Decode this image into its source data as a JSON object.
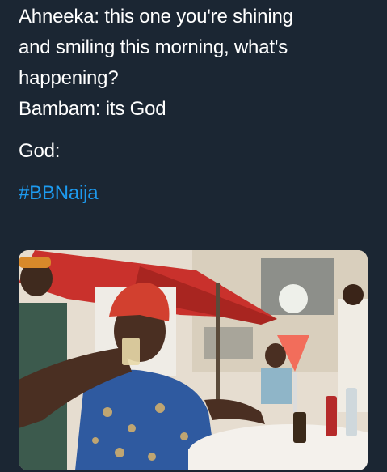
{
  "tweet": {
    "lines": [
      "Ahneeka: this one you're shining",
      "and smiling this morning, what's",
      "happening?",
      "Bambam: its God"
    ],
    "god_line": "God:",
    "hashtag": "#BBNaija"
  },
  "media": {
    "subject": "photo",
    "colors": {
      "sky": "#e9e3da",
      "canopy": "#c9312c",
      "building": "#d8cdb8",
      "cap": "#d2402f",
      "shirt": "#2f5aa0",
      "skin": "#4a2f22",
      "table": "#f4f1ec",
      "drink": "#f26d5b"
    }
  }
}
